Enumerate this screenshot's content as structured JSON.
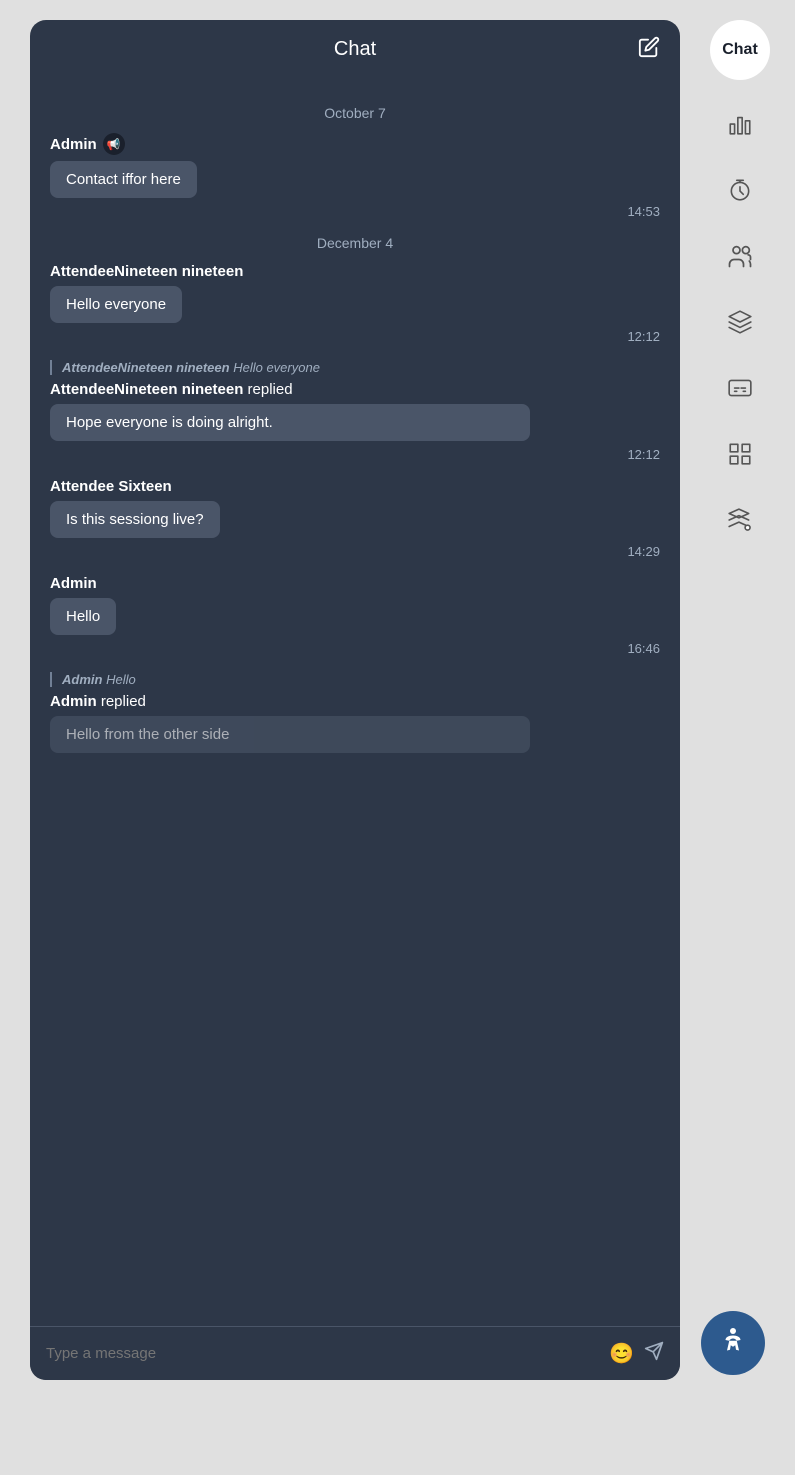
{
  "header": {
    "title": "Chat",
    "compose_icon": "✏",
    "compose_tooltip": "Compose new message"
  },
  "sidebar": {
    "items": [
      {
        "id": "chat",
        "label": "Chat",
        "type": "text",
        "active": true
      },
      {
        "id": "polls",
        "label": "Polls",
        "type": "icon",
        "icon": "chart-bar"
      },
      {
        "id": "timer",
        "label": "Timer",
        "type": "icon",
        "icon": "timer"
      },
      {
        "id": "attendees",
        "label": "Attendees",
        "type": "icon",
        "icon": "group"
      },
      {
        "id": "layers",
        "label": "Layers",
        "type": "icon",
        "icon": "layers"
      },
      {
        "id": "captions",
        "label": "Captions",
        "type": "icon",
        "icon": "cc"
      },
      {
        "id": "grid",
        "label": "Grid",
        "type": "icon",
        "icon": "grid"
      },
      {
        "id": "apps",
        "label": "Apps",
        "type": "icon",
        "icon": "apps"
      }
    ]
  },
  "messages": [
    {
      "type": "date",
      "label": "October 7"
    },
    {
      "type": "message",
      "sender": "Admin",
      "sender_type": "admin",
      "text": "Contact iffor here",
      "time": "14:53"
    },
    {
      "type": "date",
      "label": "December 4"
    },
    {
      "type": "message",
      "sender": "AttendeeNineteen nineteen",
      "sender_type": "attendee",
      "text": "Hello everyone",
      "time": "12:12"
    },
    {
      "type": "reply",
      "ref_sender": "AttendeeNineteen nineteen",
      "ref_text": "Hello everyone",
      "reply_sender": "AttendeeNineteen nineteen",
      "reply_label": "replied",
      "text": "Hope everyone is doing alright.",
      "time": "12:12"
    },
    {
      "type": "message",
      "sender": "Attendee Sixteen",
      "sender_type": "attendee",
      "text": "Is this sessiong live?",
      "time": "14:29"
    },
    {
      "type": "message",
      "sender": "Admin",
      "sender_type": "admin",
      "text": "Hello",
      "time": "16:46"
    },
    {
      "type": "reply",
      "ref_sender": "Admin",
      "ref_text": "Hello",
      "reply_sender": "Admin",
      "reply_label": "replied",
      "text": "Hello from the other side",
      "time": ""
    }
  ],
  "input": {
    "placeholder": "Type a message"
  },
  "accessibility": {
    "icon": "♿",
    "label": "Accessibility"
  }
}
